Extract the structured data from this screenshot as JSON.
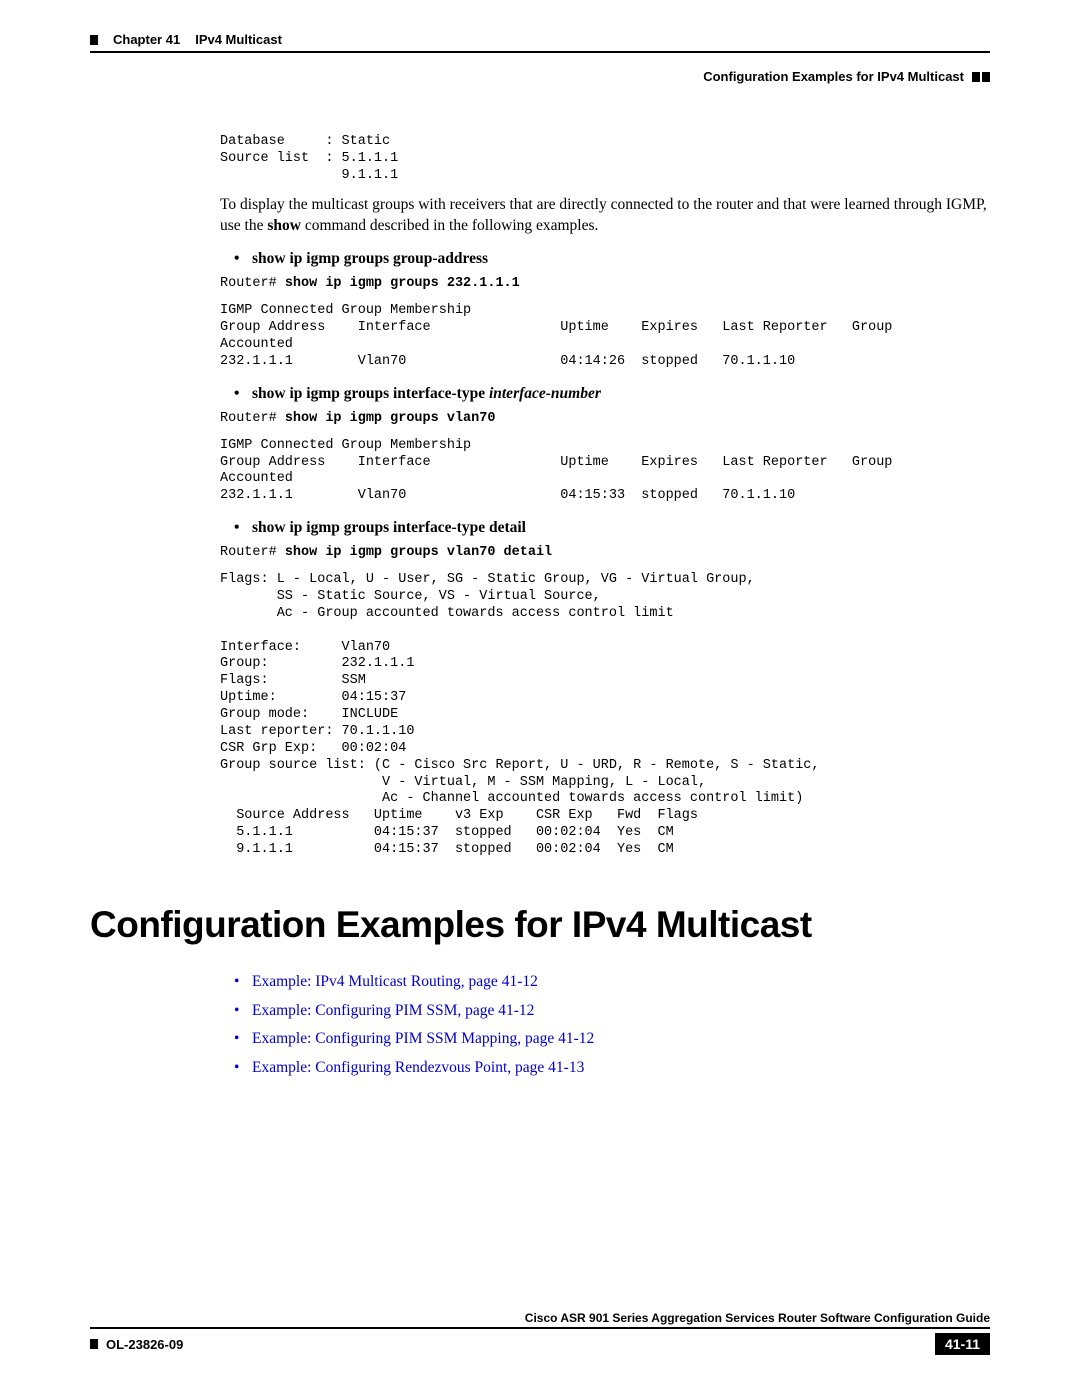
{
  "header": {
    "chapter": "Chapter 41",
    "chapter_title": "IPv4 Multicast",
    "section": "Configuration Examples for IPv4 Multicast"
  },
  "code": {
    "block1": "Database     : Static\nSource list  : 5.1.1.1\n               9.1.1.1"
  },
  "para1_part1": "To display the multicast groups with receivers that are directly connected to the router and that were learned through IGMP, use the ",
  "para1_bold": "show",
  "para1_part2": " command described in the following examples.",
  "bullet1": "show ip igmp groups group-address",
  "cmd1_prompt": "Router# ",
  "cmd1_bold": "show ip igmp groups 232.1.1.1",
  "output1": "IGMP Connected Group Membership\nGroup Address    Interface                Uptime    Expires   Last Reporter   Group \nAccounted\n232.1.1.1        Vlan70                   04:14:26  stopped   70.1.1.10",
  "bullet2_bold": "show ip igmp groups interface-type",
  "bullet2_italic": " interface-number",
  "cmd2_prompt": "Router# ",
  "cmd2_bold": "show ip igmp groups vlan70",
  "output2": "IGMP Connected Group Membership\nGroup Address    Interface                Uptime    Expires   Last Reporter   Group \nAccounted\n232.1.1.1        Vlan70                   04:15:33  stopped   70.1.1.10",
  "bullet3": "show ip igmp groups interface-type detail",
  "cmd3_prompt": "Router# ",
  "cmd3_bold": "show ip igmp groups vlan70 detail",
  "output3": "Flags: L - Local, U - User, SG - Static Group, VG - Virtual Group,\n       SS - Static Source, VS - Virtual Source,\n       Ac - Group accounted towards access control limit\n\nInterface:     Vlan70\nGroup:         232.1.1.1\nFlags:         SSM\nUptime:        04:15:37\nGroup mode:    INCLUDE\nLast reporter: 70.1.1.10\nCSR Grp Exp:   00:02:04\nGroup source list: (C - Cisco Src Report, U - URD, R - Remote, S - Static,\n                    V - Virtual, M - SSM Mapping, L - Local,\n                    Ac - Channel accounted towards access control limit)\n  Source Address   Uptime    v3 Exp    CSR Exp   Fwd  Flags\n  5.1.1.1          04:15:37  stopped   00:02:04  Yes  CM\n  9.1.1.1          04:15:37  stopped   00:02:04  Yes  CM",
  "section_title": "Configuration Examples for IPv4 Multicast",
  "links": [
    "Example: IPv4 Multicast Routing, page 41-12",
    "Example: Configuring PIM SSM, page 41-12",
    "Example: Configuring PIM SSM Mapping, page 41-12",
    "Example: Configuring Rendezvous Point, page 41-13"
  ],
  "footer": {
    "guide_title": "Cisco ASR 901 Series Aggregation Services Router Software Configuration Guide",
    "doc_id": "OL-23826-09",
    "page_num": "41-11"
  }
}
